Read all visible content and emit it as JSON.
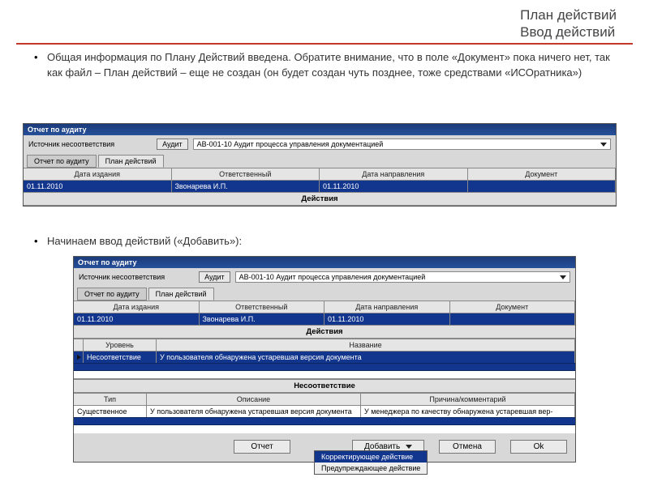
{
  "slide": {
    "title_line1": "План действий",
    "title_line2": "Ввод действий"
  },
  "paragraph1": "Общая информация по Плану Действий введена. Обратите внимание, что в поле «Документ» пока ничего нет, так как файл – План действий – еще не создан (он будет создан чуть позднее, тоже средствами «ИСОратника»)",
  "paragraph2": "Начинаем ввод действий («Добавить»):",
  "app": {
    "title": "Отчет по аудиту",
    "source_label": "Источник несоответствия",
    "audit_btn": "Аудит",
    "audit_field": "АВ-001-10  Аудит процесса управления документацией",
    "tabs": {
      "report": "Отчет по аудиту",
      "plan": "План действий"
    },
    "columns": {
      "date_issue": "Дата издания",
      "responsible": "Ответственный",
      "date_sent": "Дата направления",
      "document": "Документ"
    },
    "record": {
      "date_issue": "01.11.2010",
      "responsible": "Звонарева И.П.",
      "date_sent": "01.11.2010",
      "document": ""
    },
    "section_actions": "Действия"
  },
  "app2": {
    "actions_cols": {
      "level": "Уровень",
      "title": "Название"
    },
    "actions_row": {
      "level": "Несоответствие",
      "title": "У пользователя обнаружена устаревшая версия документа"
    },
    "section_nc": "Несоответствие",
    "nc_cols": {
      "type": "Тип",
      "desc": "Описание",
      "reason": "Причина/комментарий"
    },
    "nc_row": {
      "type": "Существенное",
      "desc": "У пользователя обнаружена устаревшая версия документа",
      "reason": "У менеджера по качеству обнаружена устаревшая вер-"
    },
    "buttons": {
      "report": "Отчет",
      "add": "Добавить",
      "cancel": "Отмена",
      "ok": "Ok"
    },
    "add_menu": {
      "corrective": "Корректирующее действие",
      "preventive": "Предупреждающее действие"
    }
  }
}
